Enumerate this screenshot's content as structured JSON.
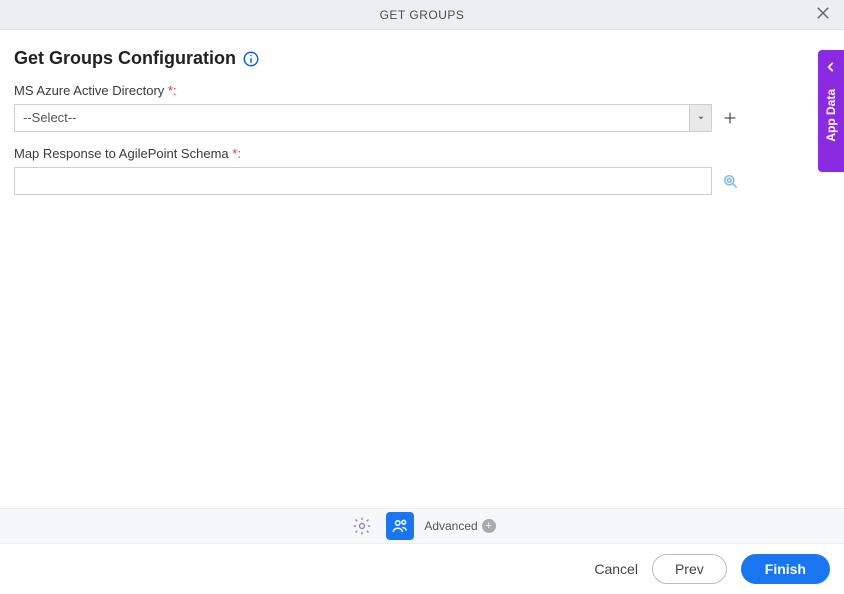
{
  "titlebar": {
    "text": "GET GROUPS"
  },
  "page": {
    "title": "Get Groups Configuration"
  },
  "fields": {
    "azure": {
      "label": "MS Azure Active Directory",
      "required_suffix": "*:",
      "selected": "--Select--"
    },
    "map": {
      "label": "Map Response to AgilePoint Schema",
      "required_suffix": "*:",
      "value": ""
    }
  },
  "toolbar": {
    "advanced_label": "Advanced"
  },
  "footer": {
    "cancel": "Cancel",
    "prev": "Prev",
    "finish": "Finish"
  },
  "side": {
    "label": "App Data"
  }
}
